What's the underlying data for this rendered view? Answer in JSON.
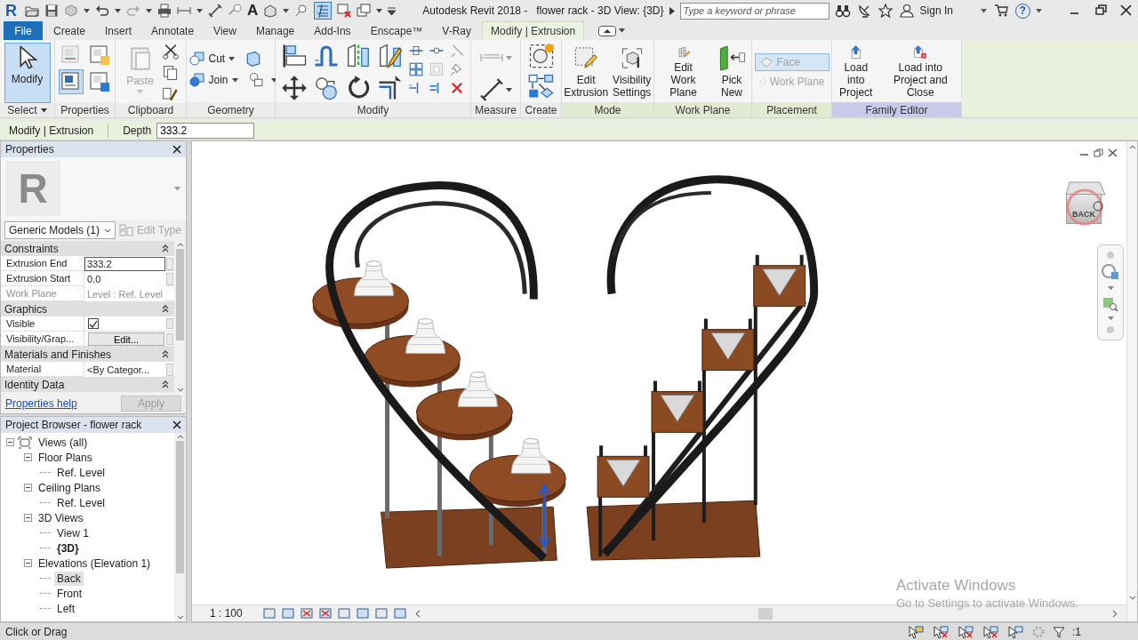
{
  "title_bar": {
    "logo": "R",
    "text_tool": "A",
    "app_title": "Autodesk Revit 2018 -",
    "document_title": "flower rack - 3D View: {3D}",
    "search": {
      "placeholder": "Type a keyword or phrase"
    },
    "sign_in": "Sign In",
    "help": "?"
  },
  "ribbon_tabs": [
    {
      "label": "File",
      "kind": "application",
      "selected": false
    },
    {
      "label": "Create",
      "kind": "tab",
      "selected": false
    },
    {
      "label": "Insert",
      "kind": "tab",
      "selected": false
    },
    {
      "label": "Annotate",
      "kind": "tab",
      "selected": false
    },
    {
      "label": "View",
      "kind": "tab",
      "selected": false
    },
    {
      "label": "Manage",
      "kind": "tab",
      "selected": false
    },
    {
      "label": "Add-Ins",
      "kind": "tab",
      "selected": false
    },
    {
      "label": "Enscape™",
      "kind": "tab",
      "selected": false
    },
    {
      "label": "V-Ray",
      "kind": "tab",
      "selected": false
    },
    {
      "label": "Modify | Extrusion",
      "kind": "contextual",
      "selected": true
    }
  ],
  "ribbon_panels": [
    {
      "label": "Select",
      "kind": "select",
      "color": "#ececec",
      "buttons": [
        {
          "label": "Modify",
          "selected": true,
          "disabled": false
        }
      ]
    },
    {
      "label": "Properties",
      "kind": "properties",
      "color": "#ececec",
      "toggles": [
        {
          "on": false
        },
        {
          "on": false
        },
        {
          "on": true
        },
        {
          "on": false
        }
      ]
    },
    {
      "label": "Clipboard",
      "kind": "clipboard",
      "color": "#ececec",
      "buttons": [
        {
          "label": "Paste",
          "selected": false,
          "disabled": true
        }
      ]
    },
    {
      "label": "Geometry",
      "kind": "geometry",
      "color": "#ececec",
      "buttons": [
        {
          "label": "Cut",
          "selected": false,
          "disabled": false
        },
        {
          "label": "Join",
          "selected": false,
          "disabled": false
        }
      ]
    },
    {
      "label": "Modify",
      "kind": "modify",
      "color": "#ececec"
    },
    {
      "label": "Measure",
      "kind": "measure",
      "color": "#ececec"
    },
    {
      "label": "Create",
      "kind": "create",
      "color": "#ececec"
    },
    {
      "label": "Mode",
      "kind": "large",
      "color": "#e2ebd2",
      "buttons": [
        {
          "label": "Edit\nExtrusion",
          "selected": false,
          "disabled": false
        },
        {
          "label": "Visibility\nSettings",
          "selected": false,
          "disabled": false
        }
      ]
    },
    {
      "label": "Work Plane",
      "kind": "large",
      "color": "#e2ebd2",
      "buttons": [
        {
          "label": "Edit\nWork Plane",
          "selected": false,
          "disabled": false
        },
        {
          "label": "Pick\nNew",
          "selected": false,
          "disabled": false
        }
      ]
    },
    {
      "label": "Placement",
      "kind": "placement",
      "color": "#e2ebd2",
      "buttons": [
        {
          "label": "Face",
          "selected": true,
          "disabled": true
        },
        {
          "label": "Work Plane",
          "selected": false,
          "disabled": true
        }
      ]
    },
    {
      "label": "Family Editor",
      "kind": "large",
      "color": "#c9cae8",
      "buttons": [
        {
          "label": "Load into\nProject",
          "selected": false,
          "disabled": false
        },
        {
          "label": "Load into\nProject and Close",
          "selected": false,
          "disabled": false
        }
      ]
    }
  ],
  "options_bar": {
    "context": "Modify | Extrusion",
    "depth": {
      "label": "Depth",
      "value": "333.2"
    }
  },
  "properties_palette": {
    "title": "Properties",
    "logo": "R",
    "type_selector": "Generic Models (1)",
    "edit_type": {
      "label": "Edit Type",
      "disabled": true
    },
    "groups": [
      {
        "label": "Constraints",
        "expanded": true,
        "rows": [
          {
            "name": "Extrusion End",
            "kind": "text",
            "value": "333.2",
            "editing": true,
            "disabled": false
          },
          {
            "name": "Extrusion Start",
            "kind": "text",
            "value": "0.0",
            "editing": false,
            "disabled": false
          },
          {
            "name": "Work Plane",
            "kind": "text",
            "value": "Level : Ref. Level",
            "editing": false,
            "disabled": true
          }
        ]
      },
      {
        "label": "Graphics",
        "expanded": true,
        "rows": [
          {
            "name": "Visible",
            "kind": "checkbox",
            "checked": true,
            "editing": false,
            "disabled": false
          },
          {
            "name": "Visibility/Grap...",
            "kind": "button",
            "value": "Edit...",
            "editing": false,
            "disabled": false
          }
        ]
      },
      {
        "label": "Materials and Finishes",
        "expanded": true,
        "rows": [
          {
            "name": "Material",
            "kind": "text",
            "value": "<By Categor...",
            "editing": false,
            "disabled": false
          }
        ]
      },
      {
        "label": "Identity Data",
        "expanded": true
      }
    ],
    "help_link": "Properties help",
    "apply": {
      "label": "Apply",
      "disabled": true
    }
  },
  "project_browser": {
    "title": "Project Browser - flower rack",
    "tree": [
      {
        "label": "Views (all)",
        "expanded": true,
        "children": [
          {
            "label": "Floor Plans",
            "expanded": true,
            "children": [
              {
                "label": "Ref. Level",
                "selected": false,
                "current": false
              }
            ]
          },
          {
            "label": "Ceiling Plans",
            "expanded": true,
            "children": [
              {
                "label": "Ref. Level",
                "selected": false,
                "current": false
              }
            ]
          },
          {
            "label": "3D Views",
            "expanded": true,
            "children": [
              {
                "label": "View 1",
                "selected": false,
                "current": false
              },
              {
                "label": "{3D}",
                "selected": false,
                "current": true
              }
            ]
          },
          {
            "label": "Elevations (Elevation 1)",
            "expanded": true,
            "children": [
              {
                "label": "Back",
                "selected": true,
                "current": false
              },
              {
                "label": "Front",
                "selected": false,
                "current": false
              },
              {
                "label": "Left",
                "selected": false,
                "current": false
              }
            ]
          }
        ]
      }
    ]
  },
  "viewport": {
    "viewcube_face": "BACK",
    "scale": "1 : 100"
  },
  "watermark": {
    "title": "Activate Windows",
    "subtitle": "Go to Settings to activate Windows."
  },
  "status_bar": {
    "prompt": "Click or Drag",
    "filter_count": ":1"
  }
}
